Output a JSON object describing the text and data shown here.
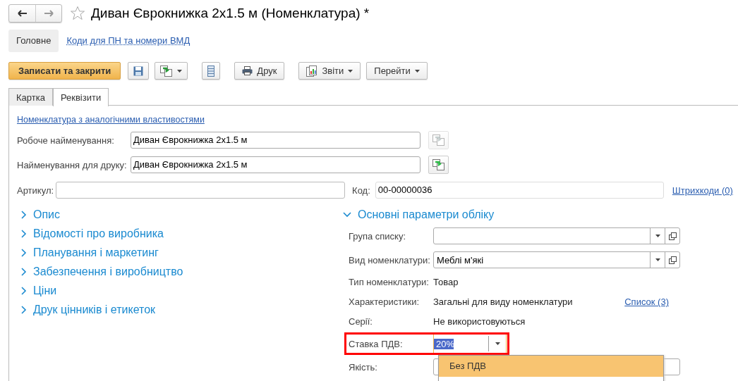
{
  "window": {
    "title": "Диван Єврокнижка 2x1.5 м (Номенклатура) *",
    "favorite": false
  },
  "nav_buttons": [
    {
      "kind": "back",
      "disabled": false
    },
    {
      "kind": "forward",
      "disabled": true
    }
  ],
  "sections": [
    {
      "label": "Головне",
      "selected": true
    },
    {
      "label": "Коди для ПН та номери ВМД",
      "selected": false
    }
  ],
  "toolbar": [
    {
      "kind": "primary",
      "label": "Записати та закрити"
    },
    {
      "kind": "save"
    },
    {
      "kind": "copy-menu"
    },
    {
      "kind": "list"
    },
    {
      "kind": "print",
      "label": "Друк"
    },
    {
      "kind": "reports",
      "label": "Звіти"
    },
    {
      "kind": "menu",
      "label": "Перейти"
    }
  ],
  "tabs": [
    {
      "label": "Картка",
      "selected": false
    },
    {
      "label": "Реквізити",
      "selected": true
    }
  ],
  "similar_link": "Номенклатура з аналогічними властивостями",
  "name_fields": [
    {
      "label": "Робоче найменування:",
      "value": "Диван Єврокнижка 2x1.5 м",
      "button_disabled": true
    },
    {
      "label": "Найменування для друку:",
      "value": "Диван Єврокнижка 2x1.5 м",
      "button_disabled": false
    }
  ],
  "article": {
    "label": "Артикул:"
  },
  "code": {
    "label": "Код:",
    "value": "00-00000036"
  },
  "barcodes_link": "Штрихкоди (0)",
  "groups": [
    {
      "label": "Опис",
      "expanded": false
    },
    {
      "label": "Відомості про виробника",
      "expanded": false
    },
    {
      "label": "Планування і маркетинг",
      "expanded": false
    },
    {
      "label": "Забезпечення і виробництво",
      "expanded": false
    },
    {
      "label": "Ціни",
      "expanded": false
    },
    {
      "label": "Друк цінників і етикеток",
      "expanded": false
    }
  ],
  "accounting": {
    "title": "Основні параметри обліку",
    "expanded": true,
    "rows": [
      {
        "kind": "combo",
        "label": "Група списку:"
      },
      {
        "kind": "combo",
        "label": "Вид номенклатури:",
        "value": "Меблі м'які"
      },
      {
        "kind": "text",
        "label": "Тип номенклатури:",
        "value": "Товар"
      },
      {
        "kind": "text",
        "label": "Характеристики:",
        "value": "Загальні для виду номенклатури",
        "link": "Список (3)"
      },
      {
        "kind": "text",
        "label": "Серії:",
        "value": "Не використовуються"
      },
      {
        "kind": "select",
        "label": "Ставка ПДВ:",
        "value": "20%",
        "highlighted": true,
        "options": [
          {
            "label": "Без ПДВ",
            "selected": true
          }
        ]
      },
      {
        "kind": "covered",
        "label": "Якість:"
      }
    ]
  }
}
